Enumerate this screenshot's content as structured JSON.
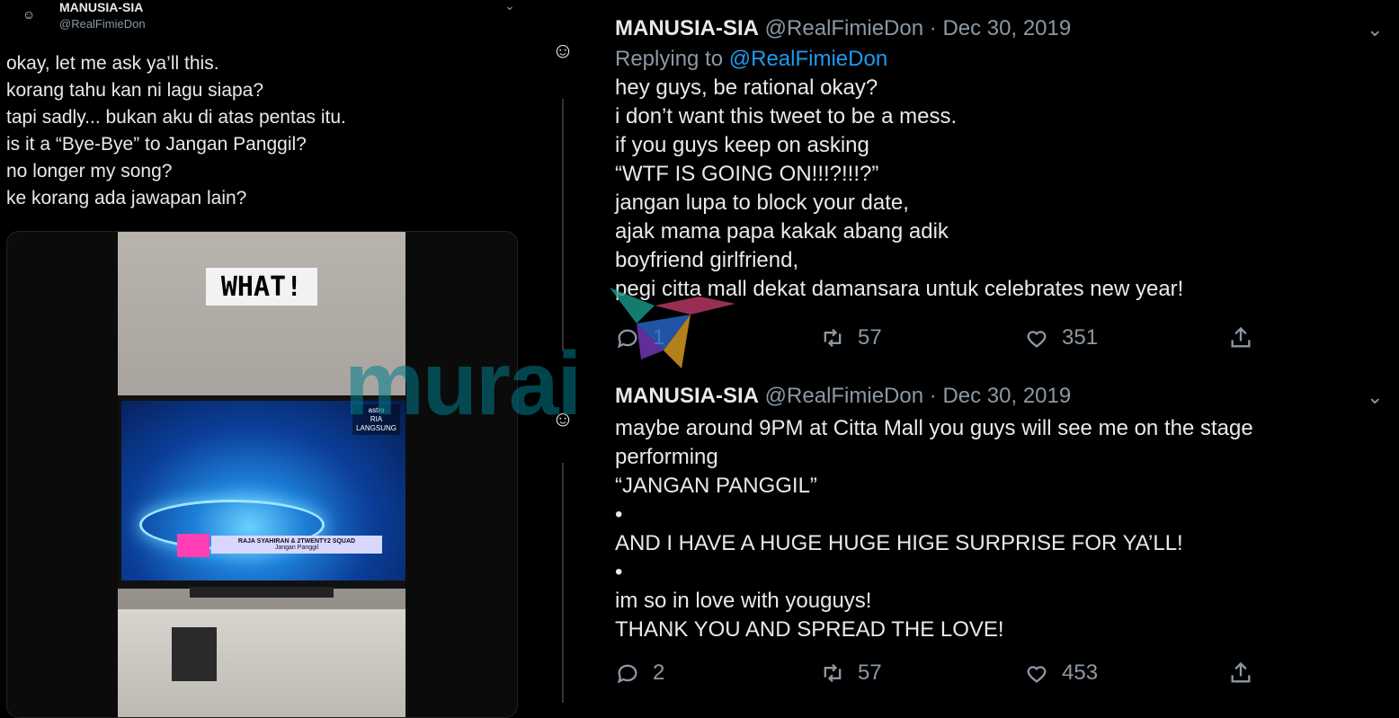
{
  "left_tweet": {
    "name": "MANUSIA-SIA",
    "handle": "@RealFimieDon",
    "lines": [
      "okay, let me ask ya’ll this.",
      "korang tahu kan ni lagu siapa?",
      "tapi sadly... bukan aku di atas pentas itu.",
      "is it a “Bye-Bye” to Jangan Panggil?",
      "no longer my song?",
      "ke korang ada jawapan lain?"
    ],
    "media": {
      "overlay_text": "WHAT!",
      "tv_logo": [
        "astro",
        "RIA",
        "LANGSUNG"
      ],
      "banner_text": "RAJA SYAHIRAN & 2TWENTY2 SQUAD",
      "banner_sub": "Jangan Panggil"
    }
  },
  "tweet1": {
    "name": "MANUSIA-SIA",
    "handle": "@RealFimieDon",
    "sep": "·",
    "date": "Dec 30, 2019",
    "replying_label": "Replying to",
    "replying_handle": "@RealFimieDon",
    "lines": [
      "hey guys, be rational okay?",
      "i don’t want this tweet to be a mess.",
      "if you guys keep on asking",
      "“WTF IS GOING ON!!!?!!!?”",
      "jangan lupa to block your date,",
      "ajak mama papa kakak abang adik",
      "boyfriend girlfriend,",
      "pegi citta mall dekat damansara untuk celebrates new year!"
    ],
    "replies": "1",
    "retweets": "57",
    "likes": "351"
  },
  "tweet2": {
    "name": "MANUSIA-SIA",
    "handle": "@RealFimieDon",
    "sep": "·",
    "date": "Dec 30, 2019",
    "lines": [
      "maybe around 9PM at Citta Mall you guys will see me on the stage",
      "performing",
      "“JANGAN PANGGIL”",
      "•",
      "AND I HAVE A HUGE HUGE HIGE SURPRISE FOR YA’LL!",
      "•",
      "im so in love with youguys!",
      "THANK YOU AND SPREAD THE LOVE!"
    ],
    "replies": "2",
    "retweets": "57",
    "likes": "453"
  },
  "watermark": {
    "text": "murai",
    "color": "#007d8c"
  },
  "icons": {
    "avatar": "smiley-avatar-icon",
    "reply": "reply-icon",
    "retweet": "retweet-icon",
    "like": "heart-icon",
    "share": "share-icon",
    "more": "chevron-down-icon"
  },
  "colors": {
    "background": "#000000",
    "link": "#1d9bf0",
    "muted": "#8b98a5",
    "text": "#e7e9ea"
  }
}
